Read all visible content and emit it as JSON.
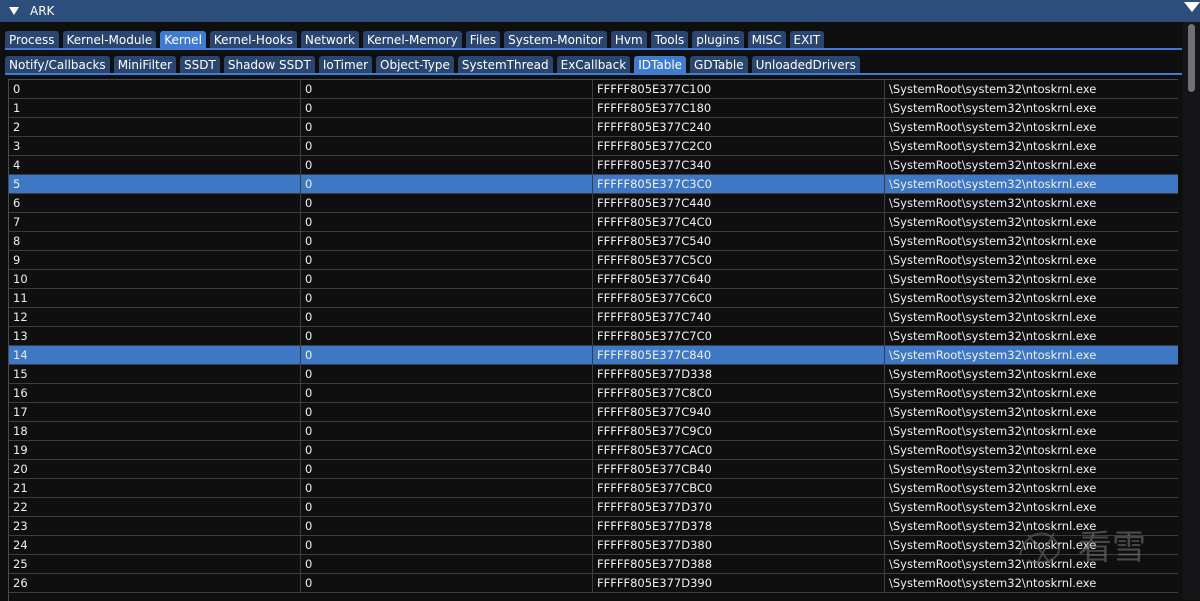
{
  "window": {
    "title": "ARK"
  },
  "main_tabs": [
    {
      "label": "Process",
      "active": false
    },
    {
      "label": "Kernel-Module",
      "active": false
    },
    {
      "label": "Kernel",
      "active": true
    },
    {
      "label": "Kernel-Hooks",
      "active": false
    },
    {
      "label": "Network",
      "active": false
    },
    {
      "label": "Kernel-Memory",
      "active": false
    },
    {
      "label": "Files",
      "active": false
    },
    {
      "label": "System-Monitor",
      "active": false
    },
    {
      "label": "Hvm",
      "active": false
    },
    {
      "label": "Tools",
      "active": false
    },
    {
      "label": "plugins",
      "active": false
    },
    {
      "label": "MISC",
      "active": false
    },
    {
      "label": "EXIT",
      "active": false
    }
  ],
  "sub_tabs": [
    {
      "label": "Notify/Callbacks",
      "active": false
    },
    {
      "label": "MiniFilter",
      "active": false
    },
    {
      "label": "SSDT",
      "active": false
    },
    {
      "label": "Shadow SSDT",
      "active": false
    },
    {
      "label": "IoTimer",
      "active": false
    },
    {
      "label": "Object-Type",
      "active": false
    },
    {
      "label": "SystemThread",
      "active": false
    },
    {
      "label": "ExCallback",
      "active": false
    },
    {
      "label": "IDTable",
      "active": true
    },
    {
      "label": "GDTable",
      "active": false
    },
    {
      "label": "UnloadedDrivers",
      "active": false
    }
  ],
  "table": {
    "rows": [
      {
        "c0": "0",
        "c1": "0",
        "c2": "FFFFF805E377C100",
        "c3": "\\SystemRoot\\system32\\ntoskrnl.exe",
        "selected": false
      },
      {
        "c0": "1",
        "c1": "0",
        "c2": "FFFFF805E377C180",
        "c3": "\\SystemRoot\\system32\\ntoskrnl.exe",
        "selected": false
      },
      {
        "c0": "2",
        "c1": "0",
        "c2": "FFFFF805E377C240",
        "c3": "\\SystemRoot\\system32\\ntoskrnl.exe",
        "selected": false
      },
      {
        "c0": "3",
        "c1": "0",
        "c2": "FFFFF805E377C2C0",
        "c3": "\\SystemRoot\\system32\\ntoskrnl.exe",
        "selected": false
      },
      {
        "c0": "4",
        "c1": "0",
        "c2": "FFFFF805E377C340",
        "c3": "\\SystemRoot\\system32\\ntoskrnl.exe",
        "selected": false
      },
      {
        "c0": "5",
        "c1": "0",
        "c2": "FFFFF805E377C3C0",
        "c3": "\\SystemRoot\\system32\\ntoskrnl.exe",
        "selected": true
      },
      {
        "c0": "6",
        "c1": "0",
        "c2": "FFFFF805E377C440",
        "c3": "\\SystemRoot\\system32\\ntoskrnl.exe",
        "selected": false
      },
      {
        "c0": "7",
        "c1": "0",
        "c2": "FFFFF805E377C4C0",
        "c3": "\\SystemRoot\\system32\\ntoskrnl.exe",
        "selected": false
      },
      {
        "c0": "8",
        "c1": "0",
        "c2": "FFFFF805E377C540",
        "c3": "\\SystemRoot\\system32\\ntoskrnl.exe",
        "selected": false
      },
      {
        "c0": "9",
        "c1": "0",
        "c2": "FFFFF805E377C5C0",
        "c3": "\\SystemRoot\\system32\\ntoskrnl.exe",
        "selected": false
      },
      {
        "c0": "10",
        "c1": "0",
        "c2": "FFFFF805E377C640",
        "c3": "\\SystemRoot\\system32\\ntoskrnl.exe",
        "selected": false
      },
      {
        "c0": "11",
        "c1": "0",
        "c2": "FFFFF805E377C6C0",
        "c3": "\\SystemRoot\\system32\\ntoskrnl.exe",
        "selected": false
      },
      {
        "c0": "12",
        "c1": "0",
        "c2": "FFFFF805E377C740",
        "c3": "\\SystemRoot\\system32\\ntoskrnl.exe",
        "selected": false
      },
      {
        "c0": "13",
        "c1": "0",
        "c2": "FFFFF805E377C7C0",
        "c3": "\\SystemRoot\\system32\\ntoskrnl.exe",
        "selected": false
      },
      {
        "c0": "14",
        "c1": "0",
        "c2": "FFFFF805E377C840",
        "c3": "\\SystemRoot\\system32\\ntoskrnl.exe",
        "selected": true
      },
      {
        "c0": "15",
        "c1": "0",
        "c2": "FFFFF805E377D338",
        "c3": "\\SystemRoot\\system32\\ntoskrnl.exe",
        "selected": false
      },
      {
        "c0": "16",
        "c1": "0",
        "c2": "FFFFF805E377C8C0",
        "c3": "\\SystemRoot\\system32\\ntoskrnl.exe",
        "selected": false
      },
      {
        "c0": "17",
        "c1": "0",
        "c2": "FFFFF805E377C940",
        "c3": "\\SystemRoot\\system32\\ntoskrnl.exe",
        "selected": false
      },
      {
        "c0": "18",
        "c1": "0",
        "c2": "FFFFF805E377C9C0",
        "c3": "\\SystemRoot\\system32\\ntoskrnl.exe",
        "selected": false
      },
      {
        "c0": "19",
        "c1": "0",
        "c2": "FFFFF805E377CAC0",
        "c3": "\\SystemRoot\\system32\\ntoskrnl.exe",
        "selected": false
      },
      {
        "c0": "20",
        "c1": "0",
        "c2": "FFFFF805E377CB40",
        "c3": "\\SystemRoot\\system32\\ntoskrnl.exe",
        "selected": false
      },
      {
        "c0": "21",
        "c1": "0",
        "c2": "FFFFF805E377CBC0",
        "c3": "\\SystemRoot\\system32\\ntoskrnl.exe",
        "selected": false
      },
      {
        "c0": "22",
        "c1": "0",
        "c2": "FFFFF805E377D370",
        "c3": "\\SystemRoot\\system32\\ntoskrnl.exe",
        "selected": false
      },
      {
        "c0": "23",
        "c1": "0",
        "c2": "FFFFF805E377D378",
        "c3": "\\SystemRoot\\system32\\ntoskrnl.exe",
        "selected": false
      },
      {
        "c0": "24",
        "c1": "0",
        "c2": "FFFFF805E377D380",
        "c3": "\\SystemRoot\\system32\\ntoskrnl.exe",
        "selected": false
      },
      {
        "c0": "25",
        "c1": "0",
        "c2": "FFFFF805E377D388",
        "c3": "\\SystemRoot\\system32\\ntoskrnl.exe",
        "selected": false
      },
      {
        "c0": "26",
        "c1": "0",
        "c2": "FFFFF805E377D390",
        "c3": "\\SystemRoot\\system32\\ntoskrnl.exe",
        "selected": false
      }
    ]
  },
  "watermark": {
    "text": "看雪"
  },
  "colors": {
    "title_bar": "#2d4d7a",
    "tab": "#2a4670",
    "tab_active": "#3f7bd1",
    "row_selected": "#3e77c4",
    "background": "#0f0f10"
  }
}
